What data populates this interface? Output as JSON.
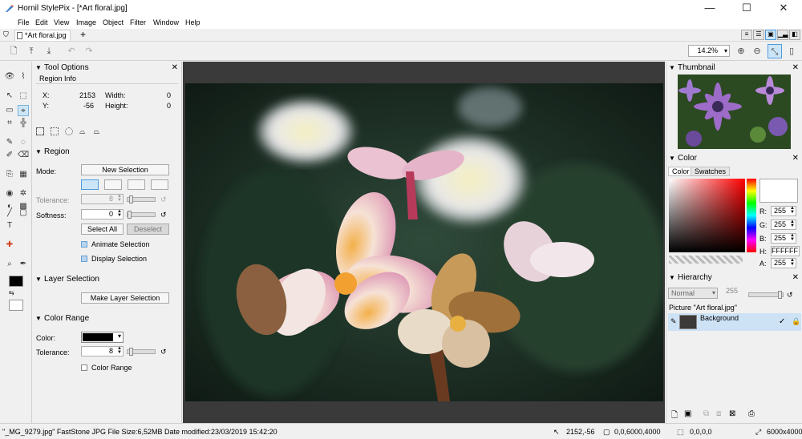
{
  "window": {
    "title": "Hornil StylePix - [*Art floral.jpg]",
    "minimize": "—",
    "maximize": "☐",
    "close": "✕"
  },
  "menu": [
    "File",
    "Edit",
    "View",
    "Image",
    "Object",
    "Filter",
    "Window",
    "Help"
  ],
  "tabs": [
    {
      "label": "*Art floral.jpg"
    }
  ],
  "tab_add": "+",
  "toolbar": {
    "zoom_value": "14.2%"
  },
  "tool_options": {
    "title": "Tool Options",
    "region_info": {
      "title": "Region Info",
      "x_label": "X:",
      "x_value": "2153",
      "y_label": "Y:",
      "y_value": "-56",
      "width_label": "Width:",
      "width_value": "0",
      "height_label": "Height:",
      "height_value": "0"
    },
    "region": {
      "title": "Region",
      "mode_label": "Mode:",
      "new_selection": "New Selection",
      "tolerance_label": "Tolerance:",
      "tolerance_value": "8",
      "softness_label": "Softness:",
      "softness_value": "0",
      "select_all": "Select All",
      "deselect": "Deselect",
      "animate_selection": "Animate Selection",
      "display_selection": "Display Selection"
    },
    "layer_selection": {
      "title": "Layer Selection",
      "make_layer_selection": "Make Layer Selection"
    },
    "color_range": {
      "title": "Color Range",
      "color_label": "Color:",
      "tolerance_label": "Tolerance:",
      "tolerance_value": "8",
      "color_range_checkbox": "Color Range"
    }
  },
  "thumbnail": {
    "title": "Thumbnail"
  },
  "color_panel": {
    "title": "Color",
    "tabs": [
      "Color",
      "Swatches"
    ],
    "r_label": "R:",
    "r_value": "255",
    "g_label": "G:",
    "g_value": "255",
    "b_label": "B:",
    "b_value": "255",
    "h_label": "H:",
    "hex_value": "FFFFFF",
    "a_label": "A:",
    "a_value": "255"
  },
  "hierarchy": {
    "title": "Hierarchy",
    "blend_mode": "Normal",
    "opacity": "255",
    "picture_label": "Picture \"Art floral.jpg\"",
    "layers": [
      {
        "name": "Background"
      }
    ]
  },
  "statusbar": {
    "file_info": "\"_MG_9279.jpg\" FastStone JPG File Size:6,52MB Date modified:23/03/2019 15:42:20",
    "cursor": "2152,-56",
    "selection": "0,0,6000,4000",
    "region": "0,0,0,0",
    "size": "6000x4000"
  },
  "colors": {
    "accent": "#4f9be0",
    "canvas_bg": "#3a3a3a",
    "selected_layer": "#cde2f5"
  }
}
